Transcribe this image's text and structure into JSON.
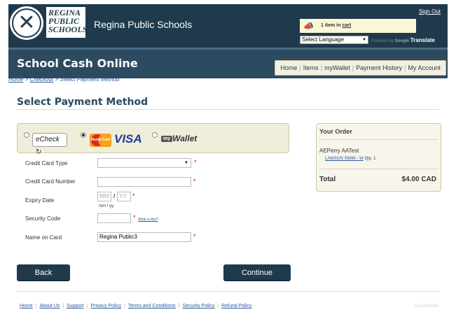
{
  "header": {
    "logo_lines": [
      "REGINA",
      "PUBLIC",
      "SCHOOLS"
    ],
    "site_title": "Regina Public Schools",
    "sign_out": "Sign Out",
    "cart_prefix": "1 item in ",
    "cart_link": "cart",
    "language_select": "Select Language",
    "powered_by": "Powered by",
    "google": "Google",
    "translate": "Translate"
  },
  "nav": {
    "app_name": "School Cash Online",
    "links": [
      "Home",
      "Items",
      "myWallet",
      "Payment History",
      "My Account"
    ]
  },
  "breadcrumb": {
    "home": "Home",
    "checkout": "Checkout",
    "current": "Select Payment Method",
    "separator": ">"
  },
  "page": {
    "title": "Select Payment Method"
  },
  "payment_methods": {
    "echeck": "eCheck",
    "mastercard": "MasterCard",
    "visa": "VISA",
    "mywallet_box": "my",
    "mywallet": "Wallet",
    "selected": "card"
  },
  "form": {
    "card_type_label": "Credit Card Type",
    "card_type_value": "",
    "card_number_label": "Credit Card Number",
    "card_number_value": "",
    "expiry_label": "Expiry Date",
    "expiry_mm_placeholder": "MM",
    "expiry_yy_placeholder": "YY",
    "expiry_separator": "/",
    "expiry_hint": "mm / yy",
    "security_label": "Security Code",
    "security_value": "",
    "what_is_this": "What is this?",
    "name_label": "Name on Card",
    "name_value": "Regina Public3",
    "required_marker": "*"
  },
  "order": {
    "title": "Your Order",
    "customer": "AEPerry AATest",
    "item_name": "LAWSON SWIM - W",
    "item_qty": "Qty: 1",
    "total_label": "Total",
    "total_value": "$4.00 CAD"
  },
  "buttons": {
    "back": "Back",
    "continue": "Continue"
  },
  "footer": {
    "links": [
      "Home",
      "About Us",
      "Support",
      "Privacy Policy",
      "Terms and Conditions",
      "Security Policy",
      "Refund Policy"
    ],
    "version": "2.3.169.5187"
  },
  "colors": {
    "header_bg": "#1f3a4d",
    "nav_bg": "#2c4a60",
    "link": "#2a5a9c",
    "required": "#dd0000",
    "panel_bg": "#f1eddb"
  },
  "icons": {
    "cart": "megaphone-cart-icon",
    "logo": "school-seal-logo-icon"
  }
}
